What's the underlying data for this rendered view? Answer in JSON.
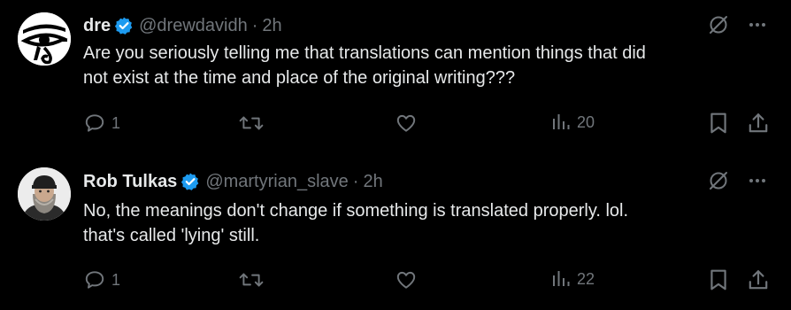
{
  "tweets": [
    {
      "name": "dre",
      "handle": "@drewdavidh",
      "separator": "·",
      "time": "2h",
      "text": "Are you seriously telling me that translations can mention things that did\nnot exist at the time and place of the original writing???",
      "replies": "1",
      "retweets": "",
      "likes": "",
      "views": "20",
      "avatar_icon": "eye-of-horus-icon"
    },
    {
      "name": "Rob Tulkas",
      "handle": "@martyrian_slave",
      "separator": "·",
      "time": "2h",
      "text": "No, the meanings don't change if something is translated properly. lol.\nthat's called 'lying' still.",
      "replies": "1",
      "retweets": "",
      "likes": "",
      "views": "22",
      "avatar_icon": "bearded-man-photo"
    }
  ],
  "colors": {
    "background": "#000000",
    "text": "#e7e9ea",
    "secondary": "#71767b",
    "verified": "#1d9bf0"
  }
}
